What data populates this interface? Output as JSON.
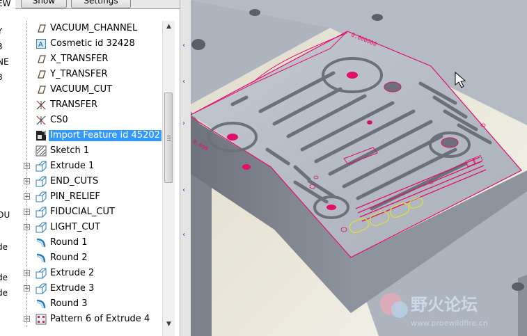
{
  "toolbar": {
    "show_label": "Show",
    "settings_label": "Settings"
  },
  "left_clip": [
    {
      "text": "EW"
    },
    {
      "text": "Y"
    },
    {
      "text": "3"
    },
    {
      "text": "NE"
    },
    {
      "text": "8"
    },
    {
      "text": "OU"
    },
    {
      "text": "de"
    },
    {
      "text": "de"
    },
    {
      "text": "de"
    }
  ],
  "tree": {
    "items": [
      {
        "label": "VACUUM_CHANNEL",
        "icon": "datum-plane-icon"
      },
      {
        "label": "Cosmetic id 32428",
        "icon": "cosmetic-icon"
      },
      {
        "label": "X_TRANSFER",
        "icon": "datum-plane-icon"
      },
      {
        "label": "Y_TRANSFER",
        "icon": "datum-plane-icon"
      },
      {
        "label": "VACUUM_CUT",
        "icon": "datum-plane-icon"
      },
      {
        "label": "TRANSFER",
        "icon": "coordinate-system-icon"
      },
      {
        "label": "CS0",
        "icon": "coordinate-system-icon"
      },
      {
        "label": "Import Feature id 45202",
        "icon": "import-feature-icon",
        "selected": true
      },
      {
        "label": "Sketch 1",
        "icon": "sketch-icon"
      },
      {
        "label": "Extrude 1",
        "icon": "extrude-icon",
        "expandable": true
      },
      {
        "label": "END_CUTS",
        "icon": "extrude-icon",
        "expandable": true
      },
      {
        "label": "PIN_RELIEF",
        "icon": "extrude-icon",
        "expandable": true
      },
      {
        "label": "FIDUCIAL_CUT",
        "icon": "extrude-icon",
        "expandable": true
      },
      {
        "label": "LIGHT_CUT",
        "icon": "extrude-icon",
        "expandable": true
      },
      {
        "label": "Round 1",
        "icon": "round-icon"
      },
      {
        "label": "Round 2",
        "icon": "round-icon"
      },
      {
        "label": "Extrude 2",
        "icon": "extrude-icon",
        "expandable": true
      },
      {
        "label": "Extrude 3",
        "icon": "extrude-icon",
        "expandable": true
      },
      {
        "label": "Round 3",
        "icon": "round-icon"
      },
      {
        "label": "Pattern 6 of Extrude 4",
        "icon": "pattern-icon",
        "expandable": true
      }
    ]
  },
  "viewport": {
    "watermark_cn": "野火论坛",
    "watermark_url": "www.proewildfire.cn"
  },
  "colors": {
    "selection": "#3399ff",
    "part_top": "#b9bfc9",
    "part_side": "#7d838e",
    "edge_highlight": "#e0106a",
    "text_yellow": "#e2df38"
  }
}
